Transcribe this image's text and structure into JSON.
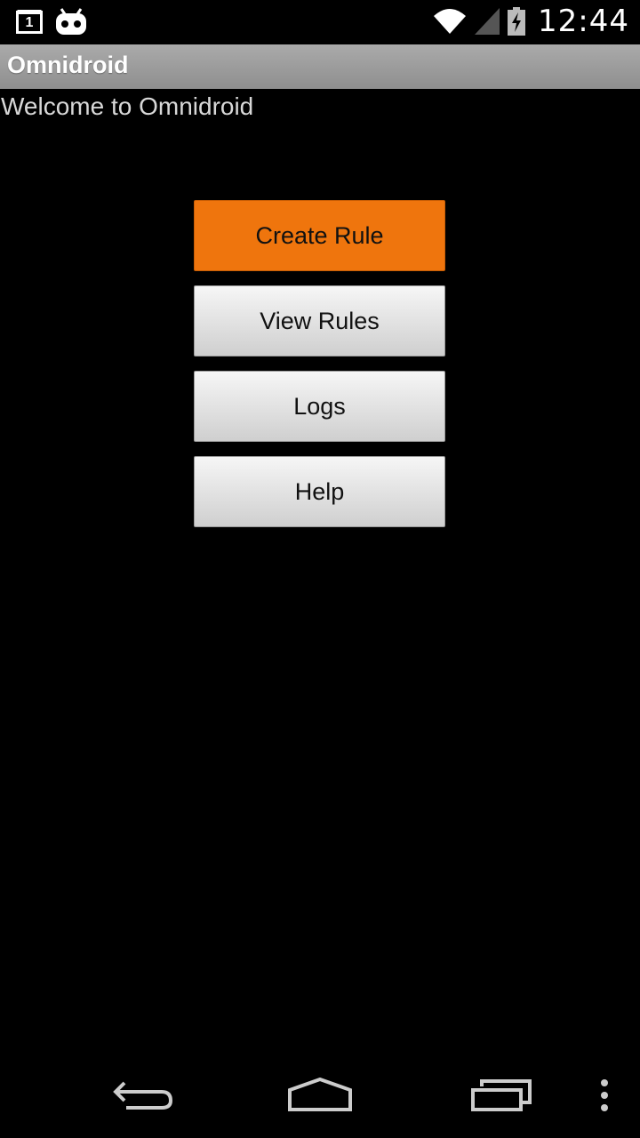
{
  "status_bar": {
    "calendar_badge": "1",
    "time": "12:44",
    "icons": [
      "calendar-notification-icon",
      "cyanogenmod-icon",
      "wifi-icon",
      "signal-icon",
      "battery-charging-icon"
    ]
  },
  "app_bar": {
    "title": "Omnidroid"
  },
  "main": {
    "welcome_text": "Welcome to Omnidroid",
    "buttons": [
      {
        "label": "Create Rule",
        "state": "focused"
      },
      {
        "label": "View Rules"
      },
      {
        "label": "Logs"
      },
      {
        "label": "Help"
      }
    ]
  },
  "nav_bar": {
    "icons": [
      "back-icon",
      "home-icon",
      "recent-apps-icon",
      "overflow-menu-icon"
    ]
  },
  "colors": {
    "accent": "#ef750d",
    "title_bar": "#9c9c9c",
    "background": "#000000"
  }
}
